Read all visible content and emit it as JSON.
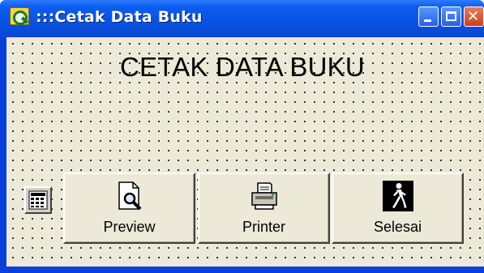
{
  "window": {
    "title": ":::Cetak Data Buku",
    "controls": {
      "minimize_icon": "minimize-icon",
      "maximize_icon": "maximize-icon",
      "close_icon": "close-icon",
      "close_glyph": "✕"
    }
  },
  "form": {
    "heading": "CETAK DATA BUKU",
    "component_icon": "keypad-icon",
    "buttons": [
      {
        "label": "Preview",
        "icon": "print-preview-icon"
      },
      {
        "label": "Printer",
        "icon": "printer-icon"
      },
      {
        "label": "Selesai",
        "icon": "walking-man-exit-icon"
      }
    ]
  },
  "colors": {
    "titlebar": "#0a53e4",
    "form_background": "#ece9d8",
    "close_button": "#c9411b"
  }
}
